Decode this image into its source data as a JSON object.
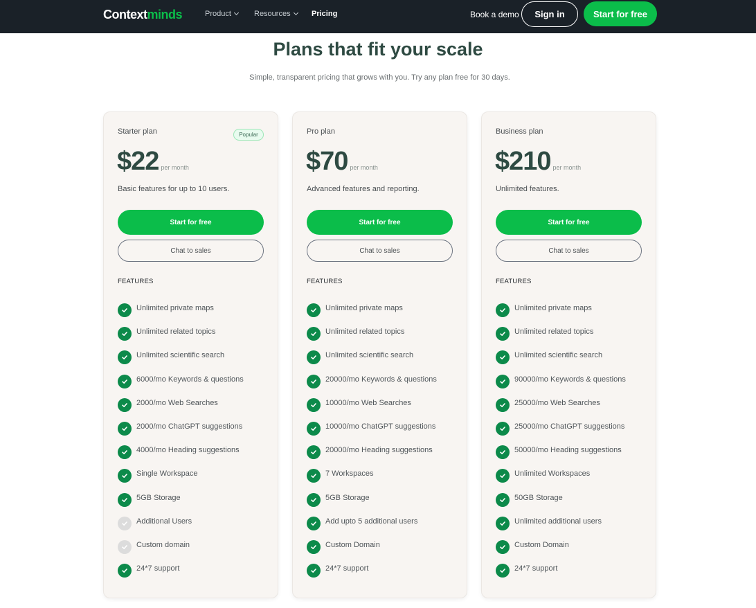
{
  "nav": {
    "logo_part1": "Context",
    "logo_part2": "minds",
    "links": [
      {
        "label": "Product",
        "has_dropdown": true
      },
      {
        "label": "Resources",
        "has_dropdown": true
      },
      {
        "label": "Pricing",
        "active": true
      }
    ],
    "book_demo": "Book a demo",
    "sign_in": "Sign in",
    "start_free": "Start for free"
  },
  "hero": {
    "title": "Plans that fit your scale",
    "subtitle": "Simple, transparent pricing that grows with you. Try any plan free for 30 days."
  },
  "colors": {
    "brand_green": "#0bbd4a",
    "check_green": "#0c8a4a",
    "nav_bg": "#1a2128",
    "heading": "#2e4a42"
  },
  "plans": [
    {
      "name": "Starter plan",
      "badge": "Popular",
      "price": "$22",
      "period": "per month",
      "description": "Basic features for up to 10 users.",
      "primary_cta": "Start for free",
      "secondary_cta": "Chat to sales",
      "features_heading": "FEATURES",
      "features": [
        {
          "label": "Unlimited private maps",
          "included": true
        },
        {
          "label": "Unlimited related topics",
          "included": true
        },
        {
          "label": "Unlimited scientific search",
          "included": true
        },
        {
          "label": "6000/mo Keywords & questions",
          "included": true
        },
        {
          "label": "2000/mo Web Searches",
          "included": true
        },
        {
          "label": "2000/mo ChatGPT suggestions",
          "included": true
        },
        {
          "label": "4000/mo Heading suggestions",
          "included": true
        },
        {
          "label": "Single Workspace",
          "included": true
        },
        {
          "label": "5GB Storage",
          "included": true
        },
        {
          "label": "Additional Users",
          "included": false
        },
        {
          "label": "Custom domain",
          "included": false
        },
        {
          "label": "24*7 support",
          "included": true
        }
      ]
    },
    {
      "name": "Pro plan",
      "badge": null,
      "price": "$70",
      "period": "per month",
      "description": "Advanced features and reporting.",
      "primary_cta": "Start for free",
      "secondary_cta": "Chat to sales",
      "features_heading": "FEATURES",
      "features": [
        {
          "label": "Unlimited private maps",
          "included": true
        },
        {
          "label": "Unlimited related topics",
          "included": true
        },
        {
          "label": "Unlimited scientific search",
          "included": true
        },
        {
          "label": "20000/mo Keywords & questions",
          "included": true
        },
        {
          "label": "10000/mo Web Searches",
          "included": true
        },
        {
          "label": "10000/mo ChatGPT suggestions",
          "included": true
        },
        {
          "label": "20000/mo Heading suggestions",
          "included": true
        },
        {
          "label": "7 Workspaces",
          "included": true
        },
        {
          "label": "5GB Storage",
          "included": true
        },
        {
          "label": "Add upto 5 additional users",
          "included": true
        },
        {
          "label": "Custom Domain",
          "included": true
        },
        {
          "label": "24*7 support",
          "included": true
        }
      ]
    },
    {
      "name": "Business plan",
      "badge": null,
      "price": "$210",
      "period": "per month",
      "description": "Unlimited features.",
      "primary_cta": "Start for free",
      "secondary_cta": "Chat to sales",
      "features_heading": "FEATURES",
      "features": [
        {
          "label": "Unlimited private maps",
          "included": true
        },
        {
          "label": "Unlimited related topics",
          "included": true
        },
        {
          "label": "Unlimited scientific search",
          "included": true
        },
        {
          "label": "90000/mo Keywords & questions",
          "included": true
        },
        {
          "label": "25000/mo Web Searches",
          "included": true
        },
        {
          "label": "25000/mo ChatGPT suggestions",
          "included": true
        },
        {
          "label": "50000/mo Heading suggestions",
          "included": true
        },
        {
          "label": "Unlimited Workspaces",
          "included": true
        },
        {
          "label": "50GB Storage",
          "included": true
        },
        {
          "label": "Unlimited additional users",
          "included": true
        },
        {
          "label": "Custom Domain",
          "included": true
        },
        {
          "label": "24*7 support",
          "included": true
        }
      ]
    }
  ]
}
